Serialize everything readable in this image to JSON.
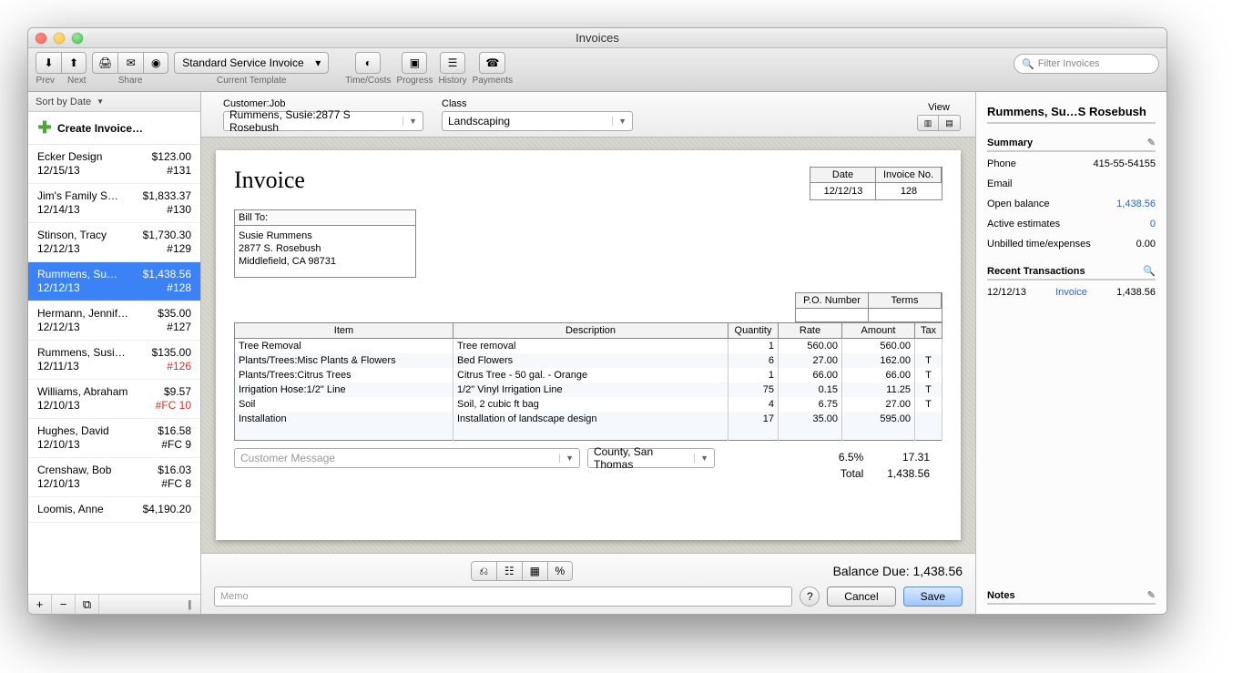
{
  "window": {
    "title": "Invoices"
  },
  "toolbar": {
    "prev_label": "Prev",
    "next_label": "Next",
    "share_label": "Share",
    "template_value": "Standard Service Invoice",
    "template_label": "Current Template",
    "timecosts_label": "Time/Costs",
    "progress_label": "Progress",
    "history_label": "History",
    "payments_label": "Payments",
    "search_placeholder": "Filter Invoices"
  },
  "sidebar": {
    "sort_label": "Sort by Date",
    "create_label": "Create Invoice…",
    "items": [
      {
        "name": "Ecker Design",
        "date": "12/15/13",
        "amount": "$123.00",
        "num": "#131",
        "red": false
      },
      {
        "name": "Jim's Family S…",
        "date": "12/14/13",
        "amount": "$1,833.37",
        "num": "#130",
        "red": false
      },
      {
        "name": "Stinson, Tracy",
        "date": "12/12/13",
        "amount": "$1,730.30",
        "num": "#129",
        "red": false
      },
      {
        "name": "Rummens, Su…",
        "date": "12/12/13",
        "amount": "$1,438.56",
        "num": "#128",
        "red": false
      },
      {
        "name": "Hermann, Jennif…",
        "date": "12/12/13",
        "amount": "$35.00",
        "num": "#127",
        "red": false
      },
      {
        "name": "Rummens, Susi…",
        "date": "12/11/13",
        "amount": "$135.00",
        "num": "#126",
        "red": true
      },
      {
        "name": "Williams, Abraham",
        "date": "12/10/13",
        "amount": "$9.57",
        "num": "#FC 10",
        "red": true
      },
      {
        "name": "Hughes, David",
        "date": "12/10/13",
        "amount": "$16.58",
        "num": "#FC 9",
        "red": false
      },
      {
        "name": "Crenshaw, Bob",
        "date": "12/10/13",
        "amount": "$16.03",
        "num": "#FC 8",
        "red": false
      },
      {
        "name": "Loomis, Anne",
        "date": "",
        "amount": "$4,190.20",
        "num": "",
        "red": false
      }
    ],
    "selected_index": 3
  },
  "header": {
    "customer_label": "Customer:Job",
    "customer_value": "Rummens, Susie:2877 S Rosebush",
    "class_label": "Class",
    "class_value": "Landscaping",
    "view_label": "View"
  },
  "invoice": {
    "title": "Invoice",
    "date_label": "Date",
    "date_value": "12/12/13",
    "num_label": "Invoice No.",
    "num_value": "128",
    "billto_label": "Bill To:",
    "billto_name": "Susie Rummens",
    "billto_addr1": "2877 S. Rosebush",
    "billto_addr2": "Middlefield, CA  98731",
    "po_label": "P.O. Number",
    "terms_label": "Terms",
    "cols": {
      "item": "Item",
      "desc": "Description",
      "qty": "Quantity",
      "rate": "Rate",
      "amount": "Amount",
      "tax": "Tax"
    },
    "lines": [
      {
        "item": "Tree Removal",
        "desc": "Tree removal",
        "qty": "1",
        "rate": "560.00",
        "amount": "560.00",
        "tax": ""
      },
      {
        "item": "Plants/Trees:Misc Plants & Flowers",
        "desc": "Bed Flowers",
        "qty": "6",
        "rate": "27.00",
        "amount": "162.00",
        "tax": "T"
      },
      {
        "item": "Plants/Trees:Citrus Trees",
        "desc": "Citrus Tree - 50 gal. - Orange",
        "qty": "1",
        "rate": "66.00",
        "amount": "66.00",
        "tax": "T"
      },
      {
        "item": "Irrigation Hose:1/2\" Line",
        "desc": "1/2\"  Vinyl Irrigation Line",
        "qty": "75",
        "rate": "0.15",
        "amount": "11.25",
        "tax": "T"
      },
      {
        "item": "Soil",
        "desc": "Soil, 2 cubic ft bag",
        "qty": "4",
        "rate": "6.75",
        "amount": "27.00",
        "tax": "T"
      },
      {
        "item": "Installation",
        "desc": "Installation of landscape design",
        "qty": "17",
        "rate": "35.00",
        "amount": "595.00",
        "tax": ""
      }
    ],
    "cust_msg_placeholder": "Customer Message",
    "tax_value": "County, San Thomas",
    "tax_rate": "6.5%",
    "tax_amount": "17.31",
    "total_label": "Total",
    "total_value": "1,438.56"
  },
  "footer": {
    "balance_label": "Balance Due:",
    "balance_value": "1,438.56",
    "memo_placeholder": "Memo",
    "cancel_label": "Cancel",
    "save_label": "Save"
  },
  "rightpanel": {
    "title": "Rummens, Su…S Rosebush",
    "summary_label": "Summary",
    "phone_label": "Phone",
    "phone_value": "415-55-54155",
    "email_label": "Email",
    "openbal_label": "Open balance",
    "openbal_value": "1,438.56",
    "active_label": "Active estimates",
    "active_value": "0",
    "unbilled_label": "Unbilled time/expenses",
    "unbilled_value": "0.00",
    "recent_label": "Recent Transactions",
    "trans_date": "12/12/13",
    "trans_type": "Invoice",
    "trans_amount": "1,438.56",
    "notes_label": "Notes"
  }
}
